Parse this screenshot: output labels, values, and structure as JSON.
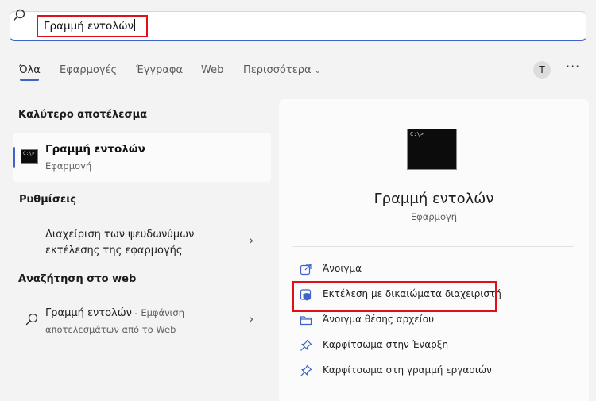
{
  "search": {
    "query": "Γραμμή εντολών"
  },
  "tabs": [
    {
      "label": "Όλα"
    },
    {
      "label": "Εφαρμογές"
    },
    {
      "label": "Έγγραφα"
    },
    {
      "label": "Web"
    },
    {
      "label": "Περισσότερα"
    }
  ],
  "user": {
    "initial": "T"
  },
  "more_label": "···",
  "best_match": {
    "section_title": "Καλύτερο αποτέλεσμα",
    "name": "Γραμμή εντολών",
    "type": "Εφαρμογή",
    "icon_text": "C:\\>_"
  },
  "settings": {
    "section_title": "Ρυθμίσεις",
    "item": "Διαχείριση των ψευδωνύμων εκτέλεσης της εφαρμογής"
  },
  "web_search": {
    "section_title": "Αναζήτηση στο web",
    "query": "Γραμμή εντολών",
    "suffix": " - Εμφάνιση αποτελεσμάτων από το Web"
  },
  "detail": {
    "title": "Γραμμή εντολών",
    "type": "Εφαρμογή",
    "icon_text": "C:\\>_",
    "actions": [
      {
        "label": "Άνοιγμα",
        "icon": "open-external-icon"
      },
      {
        "label": "Εκτέλεση με δικαιώματα διαχειριστή",
        "icon": "admin-shield-icon"
      },
      {
        "label": "Άνοιγμα θέσης αρχείου",
        "icon": "folder-icon"
      },
      {
        "label": "Καρφίτσωμα στην Έναρξη",
        "icon": "pin-icon"
      },
      {
        "label": "Καρφίτσωμα στη γραμμή εργασιών",
        "icon": "pin-icon"
      }
    ]
  },
  "colors": {
    "accent": "#3f63c7",
    "highlight": "#e0101a",
    "background": "#f3f3f3"
  }
}
